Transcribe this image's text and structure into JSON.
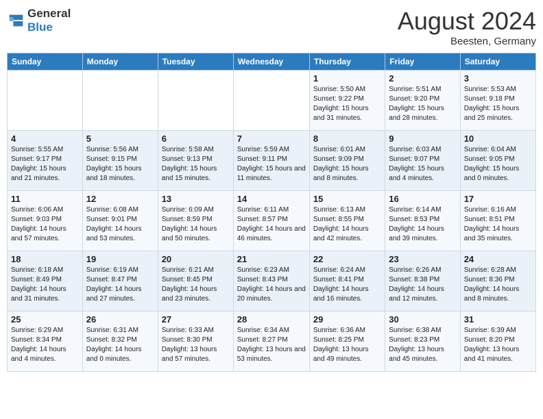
{
  "header": {
    "logo_text_normal": "General",
    "logo_text_blue": "Blue",
    "month_year": "August 2024",
    "location": "Beesten, Germany"
  },
  "weekdays": [
    "Sunday",
    "Monday",
    "Tuesday",
    "Wednesday",
    "Thursday",
    "Friday",
    "Saturday"
  ],
  "weeks": [
    [
      {
        "day": "",
        "content": ""
      },
      {
        "day": "",
        "content": ""
      },
      {
        "day": "",
        "content": ""
      },
      {
        "day": "",
        "content": ""
      },
      {
        "day": "1",
        "content": "Sunrise: 5:50 AM\nSunset: 9:22 PM\nDaylight: 15 hours\nand 31 minutes."
      },
      {
        "day": "2",
        "content": "Sunrise: 5:51 AM\nSunset: 9:20 PM\nDaylight: 15 hours\nand 28 minutes."
      },
      {
        "day": "3",
        "content": "Sunrise: 5:53 AM\nSunset: 9:18 PM\nDaylight: 15 hours\nand 25 minutes."
      }
    ],
    [
      {
        "day": "4",
        "content": "Sunrise: 5:55 AM\nSunset: 9:17 PM\nDaylight: 15 hours\nand 21 minutes."
      },
      {
        "day": "5",
        "content": "Sunrise: 5:56 AM\nSunset: 9:15 PM\nDaylight: 15 hours\nand 18 minutes."
      },
      {
        "day": "6",
        "content": "Sunrise: 5:58 AM\nSunset: 9:13 PM\nDaylight: 15 hours\nand 15 minutes."
      },
      {
        "day": "7",
        "content": "Sunrise: 5:59 AM\nSunset: 9:11 PM\nDaylight: 15 hours\nand 11 minutes."
      },
      {
        "day": "8",
        "content": "Sunrise: 6:01 AM\nSunset: 9:09 PM\nDaylight: 15 hours\nand 8 minutes."
      },
      {
        "day": "9",
        "content": "Sunrise: 6:03 AM\nSunset: 9:07 PM\nDaylight: 15 hours\nand 4 minutes."
      },
      {
        "day": "10",
        "content": "Sunrise: 6:04 AM\nSunset: 9:05 PM\nDaylight: 15 hours\nand 0 minutes."
      }
    ],
    [
      {
        "day": "11",
        "content": "Sunrise: 6:06 AM\nSunset: 9:03 PM\nDaylight: 14 hours\nand 57 minutes."
      },
      {
        "day": "12",
        "content": "Sunrise: 6:08 AM\nSunset: 9:01 PM\nDaylight: 14 hours\nand 53 minutes."
      },
      {
        "day": "13",
        "content": "Sunrise: 6:09 AM\nSunset: 8:59 PM\nDaylight: 14 hours\nand 50 minutes."
      },
      {
        "day": "14",
        "content": "Sunrise: 6:11 AM\nSunset: 8:57 PM\nDaylight: 14 hours\nand 46 minutes."
      },
      {
        "day": "15",
        "content": "Sunrise: 6:13 AM\nSunset: 8:55 PM\nDaylight: 14 hours\nand 42 minutes."
      },
      {
        "day": "16",
        "content": "Sunrise: 6:14 AM\nSunset: 8:53 PM\nDaylight: 14 hours\nand 39 minutes."
      },
      {
        "day": "17",
        "content": "Sunrise: 6:16 AM\nSunset: 8:51 PM\nDaylight: 14 hours\nand 35 minutes."
      }
    ],
    [
      {
        "day": "18",
        "content": "Sunrise: 6:18 AM\nSunset: 8:49 PM\nDaylight: 14 hours\nand 31 minutes."
      },
      {
        "day": "19",
        "content": "Sunrise: 6:19 AM\nSunset: 8:47 PM\nDaylight: 14 hours\nand 27 minutes."
      },
      {
        "day": "20",
        "content": "Sunrise: 6:21 AM\nSunset: 8:45 PM\nDaylight: 14 hours\nand 23 minutes."
      },
      {
        "day": "21",
        "content": "Sunrise: 6:23 AM\nSunset: 8:43 PM\nDaylight: 14 hours\nand 20 minutes."
      },
      {
        "day": "22",
        "content": "Sunrise: 6:24 AM\nSunset: 8:41 PM\nDaylight: 14 hours\nand 16 minutes."
      },
      {
        "day": "23",
        "content": "Sunrise: 6:26 AM\nSunset: 8:38 PM\nDaylight: 14 hours\nand 12 minutes."
      },
      {
        "day": "24",
        "content": "Sunrise: 6:28 AM\nSunset: 8:36 PM\nDaylight: 14 hours\nand 8 minutes."
      }
    ],
    [
      {
        "day": "25",
        "content": "Sunrise: 6:29 AM\nSunset: 8:34 PM\nDaylight: 14 hours\nand 4 minutes."
      },
      {
        "day": "26",
        "content": "Sunrise: 6:31 AM\nSunset: 8:32 PM\nDaylight: 14 hours\nand 0 minutes."
      },
      {
        "day": "27",
        "content": "Sunrise: 6:33 AM\nSunset: 8:30 PM\nDaylight: 13 hours\nand 57 minutes."
      },
      {
        "day": "28",
        "content": "Sunrise: 6:34 AM\nSunset: 8:27 PM\nDaylight: 13 hours\nand 53 minutes."
      },
      {
        "day": "29",
        "content": "Sunrise: 6:36 AM\nSunset: 8:25 PM\nDaylight: 13 hours\nand 49 minutes."
      },
      {
        "day": "30",
        "content": "Sunrise: 6:38 AM\nSunset: 8:23 PM\nDaylight: 13 hours\nand 45 minutes."
      },
      {
        "day": "31",
        "content": "Sunrise: 6:39 AM\nSunset: 8:20 PM\nDaylight: 13 hours\nand 41 minutes."
      }
    ]
  ]
}
